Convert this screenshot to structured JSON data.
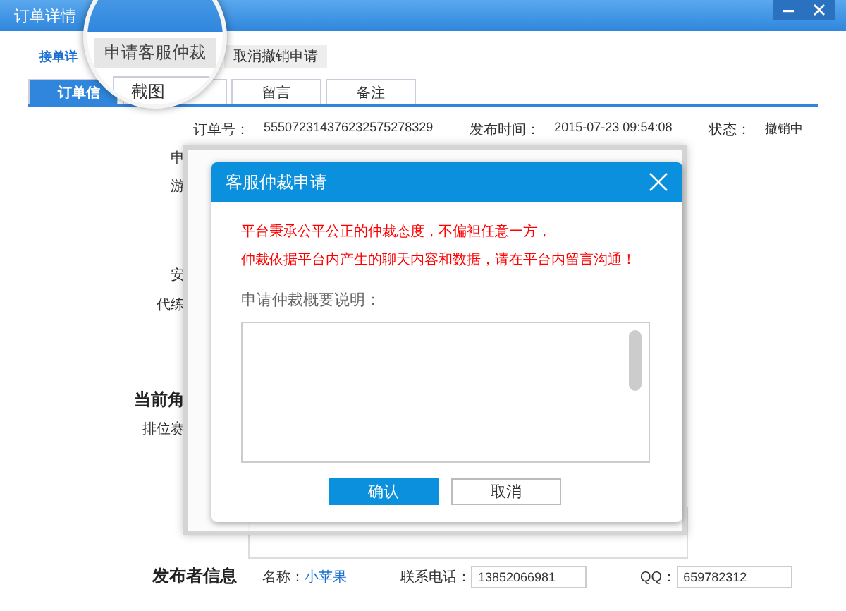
{
  "window": {
    "title": "订单详情"
  },
  "nav": {
    "link": "接单详",
    "buttons": [
      {
        "label": "申请客服仲裁",
        "kind": "magnified"
      },
      {
        "label": "取消撤销申请",
        "kind": "plain"
      }
    ]
  },
  "tabs": [
    {
      "label": "订单信",
      "selected": true
    },
    {
      "label": "截图",
      "selected": false
    },
    {
      "label": "留言",
      "selected": false
    },
    {
      "label": "备注",
      "selected": false
    }
  ],
  "order": [
    {
      "label": "订单号：",
      "value": "555072314376232575278329"
    },
    {
      "label": "发布时间：",
      "value": "2015-07-23 09:54:08"
    },
    {
      "label": "状态：",
      "value": "撤销中"
    }
  ],
  "side_labels": [
    {
      "text": "申",
      "kind": "normal"
    },
    {
      "text": "游",
      "kind": "normal"
    },
    {
      "text": "安",
      "kind": "normal"
    },
    {
      "text": "代练",
      "kind": "normal"
    },
    {
      "text": "当前角",
      "kind": "heading"
    },
    {
      "text": "排位赛",
      "kind": "normal"
    }
  ],
  "dialog": {
    "title": "客服仲裁申请",
    "notice": [
      "平台秉承公平公正的仲裁态度，不偏袒任意一方，",
      "仲裁依据平台内产生的聊天内容和数据，请在平台内留言沟通！"
    ],
    "field_label": "申请仲裁概要说明：",
    "buttons": [
      {
        "label": "确认",
        "primary": true
      },
      {
        "label": "取消",
        "primary": false
      }
    ]
  },
  "publisher": {
    "heading": "发布者信息",
    "fields": [
      {
        "label": "名称：",
        "value": "小苹果",
        "kind": "link"
      },
      {
        "label": "联系电话：",
        "value": "13852066981",
        "kind": "input"
      },
      {
        "label": "QQ：",
        "value": "659782312",
        "kind": "input"
      }
    ]
  }
}
